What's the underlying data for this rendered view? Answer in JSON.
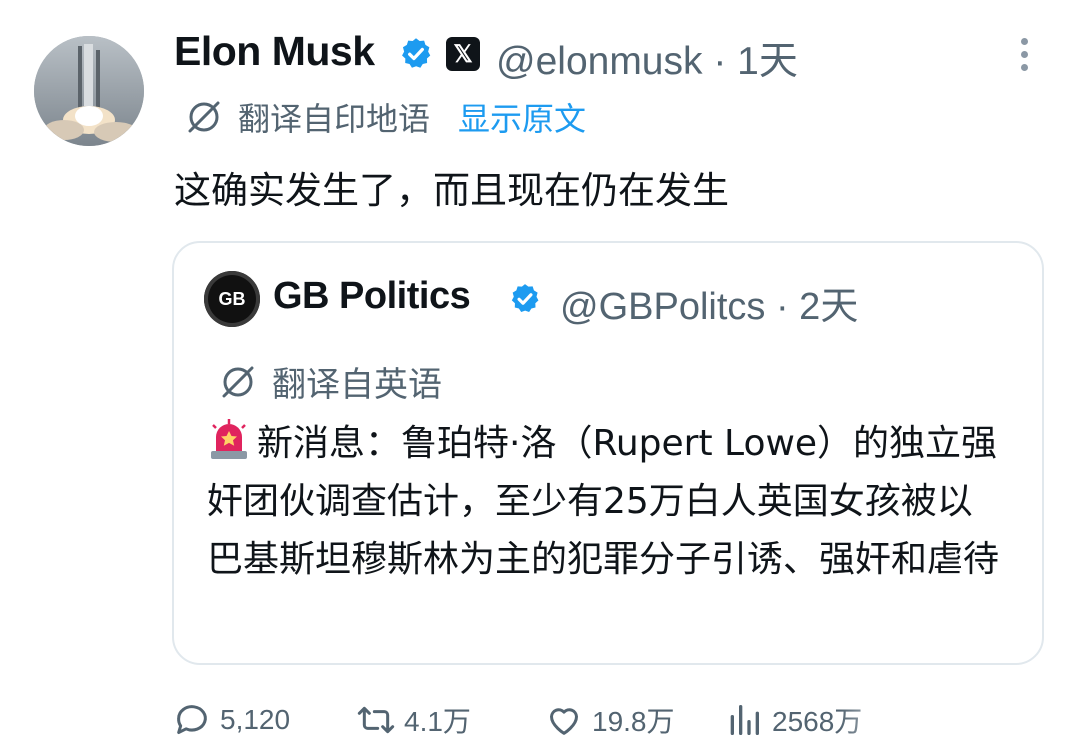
{
  "post": {
    "author_name": "Elon Musk",
    "author_handle": "@elonmusk",
    "time": "· 1天",
    "translate_label": "翻译自印地语",
    "show_original": "显示原文",
    "text": "这确实发生了，而且现在仍在发生"
  },
  "quote": {
    "avatar_text": "GB",
    "author_name": "GB Politics",
    "author_handle": "@GBPolitcs",
    "time": "· 2天",
    "translate_label": "翻译自英语",
    "text": "新消息：鲁珀特·洛（Rupert Lowe）的独立强奸团伙调查估计，至少有25万白人英国女孩被以巴基斯坦穆斯林为主的犯罪分子引诱、强奸和虐待"
  },
  "actions": {
    "replies": "5,120",
    "reposts": "4.1万",
    "likes": "19.8万",
    "views": "2568万"
  },
  "colors": {
    "verified": "#1d9bf0",
    "link": "#1d9bf0",
    "muted": "#536471",
    "siren": "#e0245e"
  },
  "icons": [
    "verified-badge-icon",
    "x-logo-icon",
    "more-icon",
    "translate-icon",
    "siren-icon",
    "reply-icon",
    "repost-icon",
    "like-icon",
    "views-icon"
  ]
}
